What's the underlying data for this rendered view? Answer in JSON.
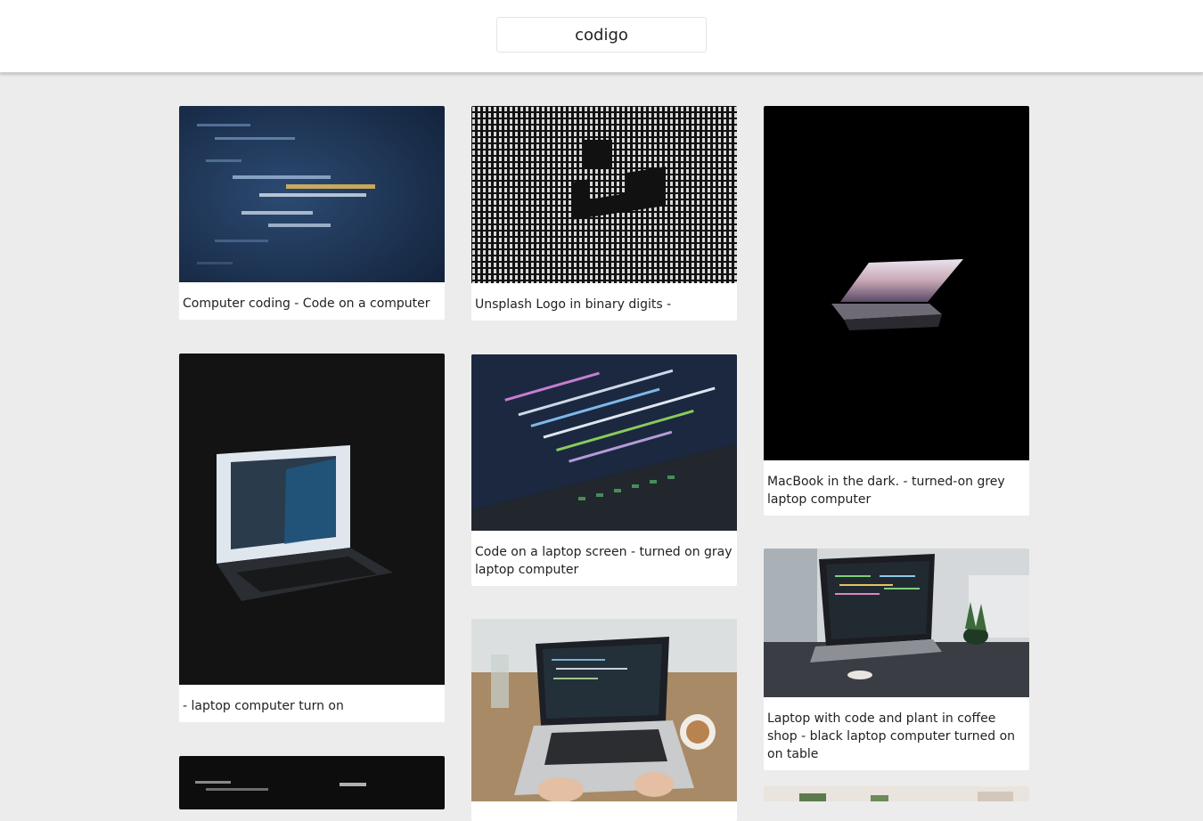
{
  "search": {
    "value": "codigo",
    "placeholder": ""
  },
  "cards": [
    {
      "caption": "Computer coding - Code on a computer",
      "image": "code-screen-blue"
    },
    {
      "caption": "Unsplash Logo in binary digits -",
      "image": "binary-logo"
    },
    {
      "caption": "MacBook in the dark. - turned-on grey laptop computer",
      "image": "macbook-dark"
    },
    {
      "caption": "- laptop computer turn on",
      "image": "laptop-on-dark"
    },
    {
      "caption": "Code on a laptop screen - turned on gray laptop computer",
      "image": "code-laptop-screen"
    },
    {
      "caption": "Laptop with code and plant in coffee shop - black laptop computer turned on on table",
      "image": "laptop-coffee-plant"
    },
    {
      "caption": "",
      "image": "dark-code-partial"
    },
    {
      "caption": "",
      "image": "laptop-wood-table"
    },
    {
      "caption": "",
      "image": "plant-partial"
    }
  ],
  "colors": {
    "background": "#ececec",
    "card": "#ffffff",
    "text": "#222222"
  }
}
